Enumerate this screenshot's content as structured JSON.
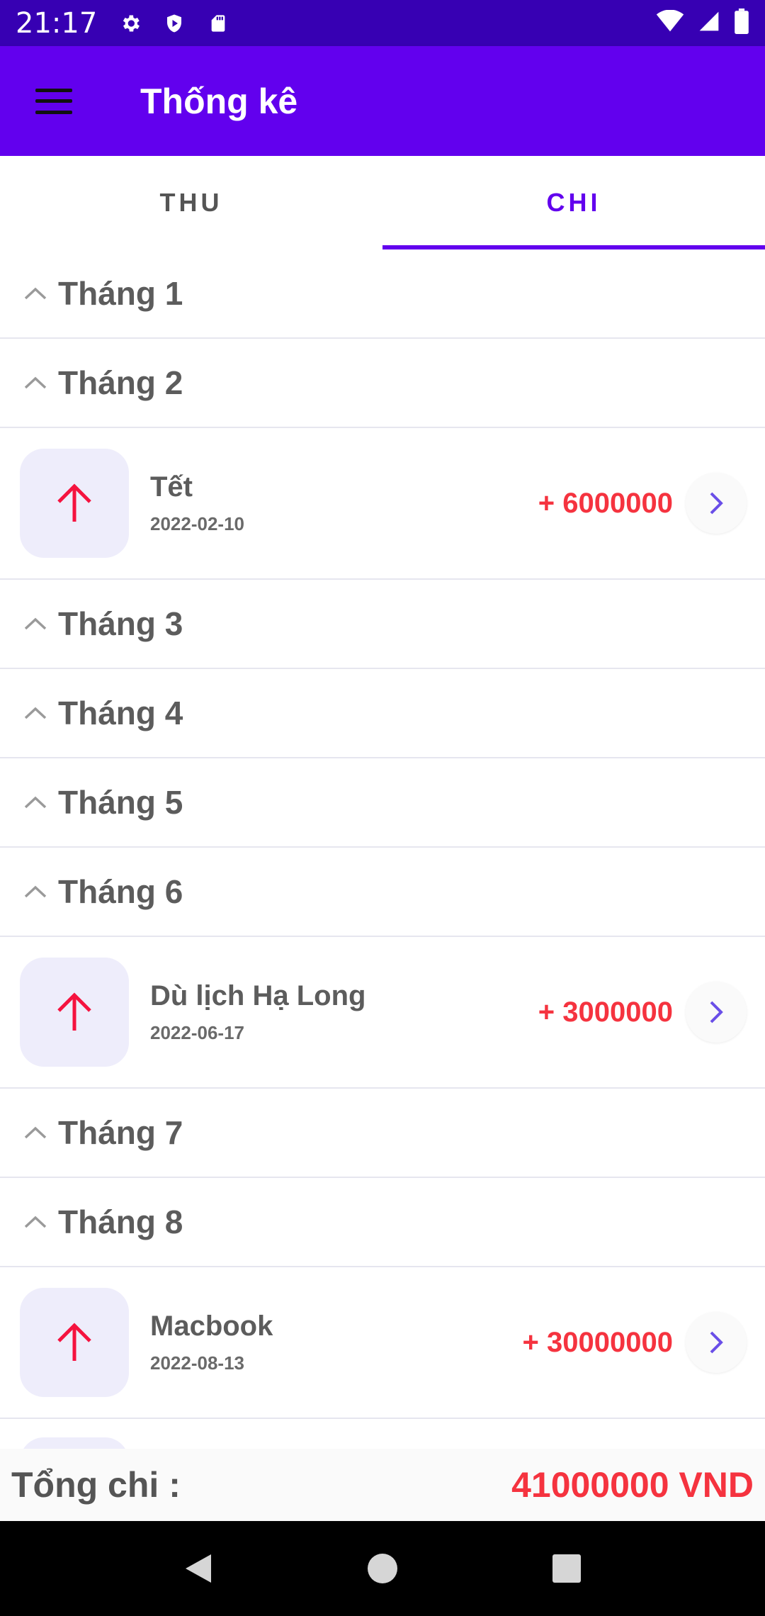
{
  "status_bar": {
    "time": "21:17",
    "icons_left": [
      "gear-icon",
      "shield-icon",
      "sd-card-icon"
    ],
    "icons_right": [
      "wifi-icon",
      "signal-icon",
      "battery-icon"
    ]
  },
  "app_bar": {
    "title": "Thống kê",
    "menu_icon": "menu-icon"
  },
  "tabs": [
    {
      "label": "THU",
      "active": false
    },
    {
      "label": "CHI",
      "active": true
    }
  ],
  "months": [
    {
      "label": "Tháng 1",
      "transactions": []
    },
    {
      "label": "Tháng 2",
      "transactions": [
        {
          "name": "Tết",
          "date": "2022-02-10",
          "amount": "+ 6000000"
        }
      ]
    },
    {
      "label": "Tháng 3",
      "transactions": []
    },
    {
      "label": "Tháng 4",
      "transactions": []
    },
    {
      "label": "Tháng 5",
      "transactions": []
    },
    {
      "label": "Tháng 6",
      "transactions": [
        {
          "name": "Dù lịch Hạ Long",
          "date": "2022-06-17",
          "amount": "+ 3000000"
        }
      ]
    },
    {
      "label": "Tháng 7",
      "transactions": []
    },
    {
      "label": "Tháng 8",
      "transactions": [
        {
          "name": "Macbook",
          "date": "2022-08-13",
          "amount": "+ 30000000"
        }
      ]
    }
  ],
  "total": {
    "label": "Tổng chi :",
    "value": "41000000 VND"
  },
  "colors": {
    "status_bar": "#3700B3",
    "app_bar": "#6200EE",
    "accent": "#6200EE",
    "amount_red": "#F5333F",
    "icon_bg": "#EEEDFB"
  }
}
